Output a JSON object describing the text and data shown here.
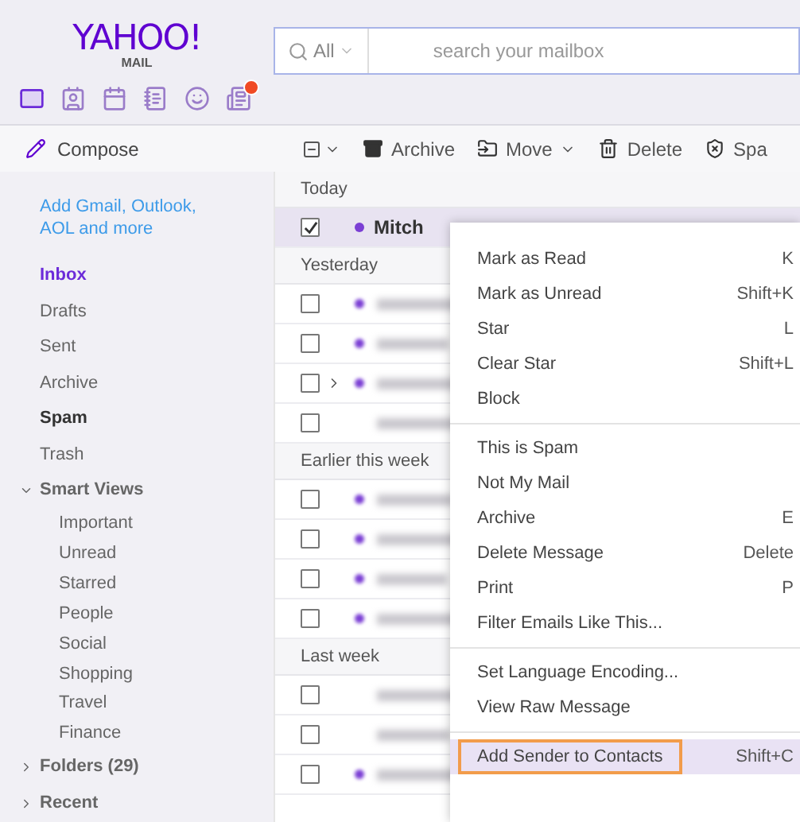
{
  "header": {
    "logo": "YAHOO!",
    "logo_sub": "MAIL",
    "search": {
      "scope": "All",
      "placeholder": "search your mailbox"
    }
  },
  "apps": [
    {
      "kind": "mail",
      "selected": true
    },
    {
      "kind": "contacts",
      "selected": false
    },
    {
      "kind": "calendar",
      "selected": false
    },
    {
      "kind": "notepad",
      "selected": false
    },
    {
      "kind": "messenger",
      "selected": false
    },
    {
      "kind": "news",
      "selected": false,
      "alert": true
    }
  ],
  "compose": "Compose",
  "toolbar": [
    {
      "kind": "select"
    },
    {
      "kind": "archive",
      "label": "Archive"
    },
    {
      "kind": "move",
      "label": "Move"
    },
    {
      "kind": "delete",
      "label": "Delete"
    },
    {
      "kind": "spam",
      "label": "Spa"
    }
  ],
  "sidebar": {
    "add_accounts": "Add Gmail, Outlook, AOL and more",
    "folders": [
      {
        "label": "Inbox",
        "selected": true,
        "bold": true
      },
      {
        "label": "Drafts",
        "selected": false,
        "bold": false
      },
      {
        "label": "Sent",
        "selected": false,
        "bold": false
      },
      {
        "label": "Archive",
        "selected": false,
        "bold": false
      },
      {
        "label": "Spam",
        "selected": false,
        "bold": true
      },
      {
        "label": "Trash",
        "selected": false,
        "bold": false
      }
    ],
    "smart_views": {
      "label": "Smart Views",
      "expanded": true,
      "children": [
        "Important",
        "Unread",
        "Starred",
        "People",
        "Social",
        "Shopping",
        "Travel",
        "Finance"
      ]
    },
    "sections": [
      {
        "label": "Folders (29)",
        "expanded": false
      },
      {
        "label": "Recent",
        "expanded": false
      }
    ]
  },
  "groups": [
    {
      "label": "Today",
      "rows": [
        {
          "sender": "Mitch",
          "checked": true,
          "selected": true,
          "unread": true,
          "thread": false
        }
      ]
    },
    {
      "label": "Yesterday",
      "rows": [
        {
          "checked": false,
          "selected": false,
          "unread": true,
          "thread": false
        },
        {
          "checked": false,
          "selected": false,
          "unread": true,
          "thread": false
        },
        {
          "checked": false,
          "selected": false,
          "unread": true,
          "thread": true
        },
        {
          "checked": false,
          "selected": false,
          "unread": false,
          "thread": false
        }
      ]
    },
    {
      "label": "Earlier this week",
      "rows": [
        {
          "checked": false,
          "selected": false,
          "unread": true,
          "thread": false
        },
        {
          "checked": false,
          "selected": false,
          "unread": true,
          "thread": false
        },
        {
          "checked": false,
          "selected": false,
          "unread": true,
          "thread": false
        },
        {
          "checked": false,
          "selected": false,
          "unread": true,
          "thread": false
        }
      ]
    },
    {
      "label": "Last week",
      "rows": [
        {
          "checked": false,
          "selected": false,
          "unread": false,
          "thread": false
        },
        {
          "checked": false,
          "selected": false,
          "unread": false,
          "thread": false
        },
        {
          "checked": false,
          "selected": false,
          "unread": true,
          "thread": false
        }
      ]
    }
  ],
  "context_menu": [
    [
      {
        "label": "Mark as Read",
        "shortcut": "K",
        "selected": false
      },
      {
        "label": "Mark as Unread",
        "shortcut": "Shift+K",
        "selected": false
      },
      {
        "label": "Star",
        "shortcut": "L",
        "selected": false
      },
      {
        "label": "Clear Star",
        "shortcut": "Shift+L",
        "selected": false
      },
      {
        "label": "Block",
        "selected": false
      }
    ],
    [
      {
        "label": "This is Spam",
        "selected": false
      },
      {
        "label": "Not My Mail",
        "selected": false
      },
      {
        "label": "Archive",
        "shortcut": "E",
        "selected": false
      },
      {
        "label": "Delete Message",
        "shortcut": "Delete",
        "selected": false
      },
      {
        "label": "Print",
        "shortcut": "P",
        "selected": false
      },
      {
        "label": "Filter Emails Like This...",
        "selected": false
      }
    ],
    [
      {
        "label": "Set Language Encoding...",
        "selected": false
      },
      {
        "label": "View Raw Message",
        "selected": false
      }
    ],
    [
      {
        "label": "Add Sender to Contacts",
        "shortcut": "Shift+C",
        "selected": true
      }
    ]
  ]
}
